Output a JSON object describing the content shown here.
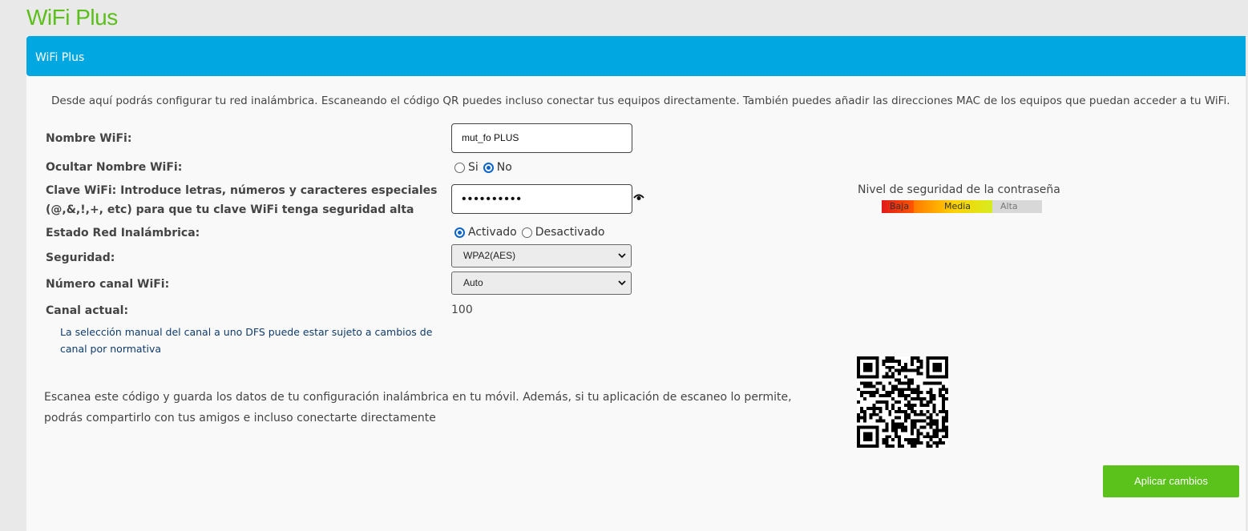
{
  "app": {
    "title": "WiFi Plus"
  },
  "panel": {
    "header": "WiFi Plus",
    "intro": "Desde aquí podrás configurar tu red inalámbrica. Escaneando el código QR puedes incluso conectar tus equipos directamente. También puedes añadir las direcciones MAC de los equipos que puedan acceder a tu WiFi."
  },
  "form": {
    "wifi_name": {
      "label": "Nombre WiFi:",
      "value": "mut_fo PLUS"
    },
    "hide_name": {
      "label": "Ocultar Nombre WiFi:",
      "options": [
        "Si",
        "No"
      ],
      "selected": "No"
    },
    "wifi_key": {
      "label_line1": "Clave WiFi: Introduce letras, números y caracteres especiales",
      "label_line2": "(@,&,!,+, etc) para que tu clave WiFi tenga seguridad alta",
      "value": "••••••••••"
    },
    "wireless_state": {
      "label": "Estado Red Inalámbrica:",
      "options": [
        "Activado",
        "Desactivado"
      ],
      "selected": "Activado"
    },
    "security": {
      "label": "Seguridad:",
      "value": "WPA2(AES)"
    },
    "channel": {
      "label": "Número canal WiFi:",
      "value": "Auto"
    },
    "current_channel": {
      "label": "Canal actual:",
      "value": "100"
    },
    "dfs_note": "La selección manual del canal a uno DFS puede estar sujeto a cambios de canal por normativa"
  },
  "strength": {
    "title": "Nivel de seguridad de la contraseña",
    "levels": [
      "Baja",
      "Media",
      "Alta"
    ],
    "level": "Media"
  },
  "qr": {
    "text": "Escanea este código y guarda los datos de tu configuración inalámbrica en tu móvil. Además, si tu aplicación de escaneo lo permite, podrás compartirlo con tus amigos e incluso conectarte directamente"
  },
  "actions": {
    "apply": "Aplicar cambios"
  },
  "colors": {
    "brand_green": "#5bbf1a",
    "header_blue": "#00a7e1",
    "radio_blue": "#0a64c9",
    "button_green": "#5bc21b"
  }
}
